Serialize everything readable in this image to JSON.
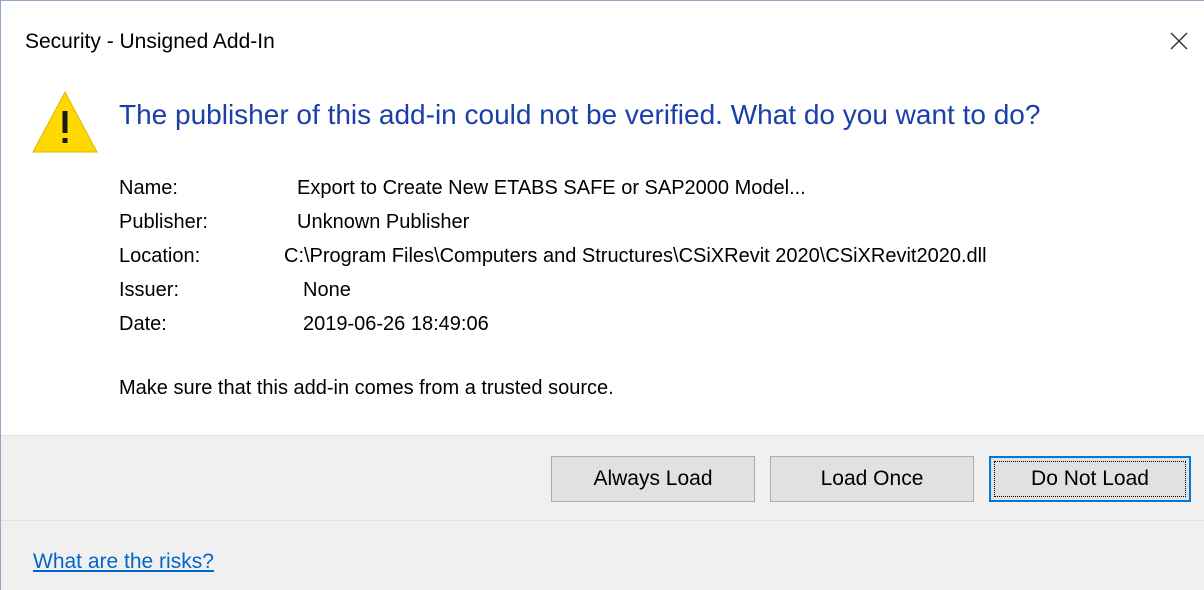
{
  "window": {
    "title": "Security - Unsigned Add-In",
    "close_icon": "close-icon"
  },
  "warning": {
    "icon": "warning-triangle-icon",
    "color": "#ffd800",
    "headline": "The publisher of this add-in could not be verified. What do you want to do?",
    "headline_color": "#1a3fa8"
  },
  "details": {
    "name_label": "Name:",
    "name_value": "Export to Create New ETABS SAFE or SAP2000 Model...",
    "publisher_label": "Publisher:",
    "publisher_value": "Unknown Publisher",
    "location_label": "Location:",
    "location_value": "C:\\Program Files\\Computers and Structures\\CSiXRevit 2020\\CSiXRevit2020.dll",
    "issuer_label": "Issuer:",
    "issuer_value": "None",
    "date_label": "Date:",
    "date_value": "2019-06-26 18:49:06"
  },
  "trust_note": "Make sure that this add-in comes from a trusted source.",
  "buttons": {
    "always_load": "Always Load",
    "load_once": "Load Once",
    "do_not_load": "Do Not Load",
    "default_accent": "#0078d7"
  },
  "footer": {
    "risks_link": "What are the risks?",
    "link_color": "#0066cc"
  }
}
